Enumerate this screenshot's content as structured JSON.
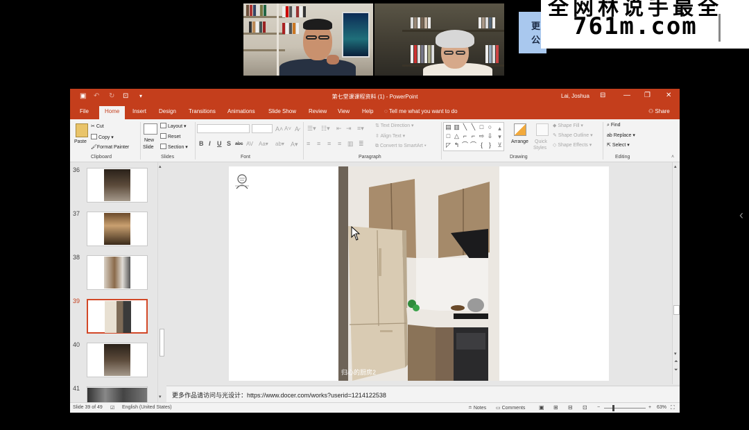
{
  "watermark": {
    "top_text": "全网林说手最全",
    "site": "761m.com",
    "side_text": "更公"
  },
  "titlebar": {
    "doc_title": "第七堂课课程资料 (1)  -  PowerPoint",
    "user": "Lai, Joshua"
  },
  "tabs": [
    "File",
    "Home",
    "Insert",
    "Design",
    "Transitions",
    "Animations",
    "Slide Show",
    "Review",
    "View",
    "Help"
  ],
  "tell_me": "Tell me what you want to do",
  "share": "Share",
  "ribbon": {
    "clipboard": {
      "label": "Clipboard",
      "paste": "Paste",
      "cut": "Cut",
      "copy": "Copy",
      "format_painter": "Format Painter"
    },
    "slides": {
      "label": "Slides",
      "new_slide": "New",
      "new_slide_2": "Slide",
      "layout": "Layout",
      "reset": "Reset",
      "section": "Section"
    },
    "font": {
      "label": "Font",
      "bold": "B",
      "italic": "I",
      "underline": "U",
      "shadow": "S",
      "strike": "abc"
    },
    "paragraph": {
      "label": "Paragraph",
      "text_direction": "Text Direction",
      "align_text": "Align Text",
      "smartart": "Convert to SmartArt"
    },
    "drawing": {
      "label": "Drawing",
      "arrange": "Arrange",
      "quick_styles": "Quick",
      "quick_styles_2": "Styles",
      "shape_fill": "Shape Fill",
      "shape_outline": "Shape Outline",
      "shape_effects": "Shape Effects"
    },
    "editing": {
      "label": "Editing",
      "find": "Find",
      "replace": "Replace",
      "select": "Select"
    }
  },
  "thumbnails": [
    {
      "num": "36",
      "selected": false
    },
    {
      "num": "37",
      "selected": false
    },
    {
      "num": "38",
      "selected": false
    },
    {
      "num": "39",
      "selected": true
    },
    {
      "num": "40",
      "selected": false
    },
    {
      "num": "41",
      "selected": false
    }
  ],
  "slide": {
    "caption": "归心的厨房2"
  },
  "notes": "更多作品请访问与光设计：https://www.docer.com/works?userid=1214122538",
  "status": {
    "slide_of": "Slide 39 of 49",
    "language": "English (United States)",
    "notes": "Notes",
    "comments": "Comments",
    "zoom": "63%"
  },
  "colors": {
    "accent": "#c43e1c",
    "selected_thumb": "#d24726"
  }
}
